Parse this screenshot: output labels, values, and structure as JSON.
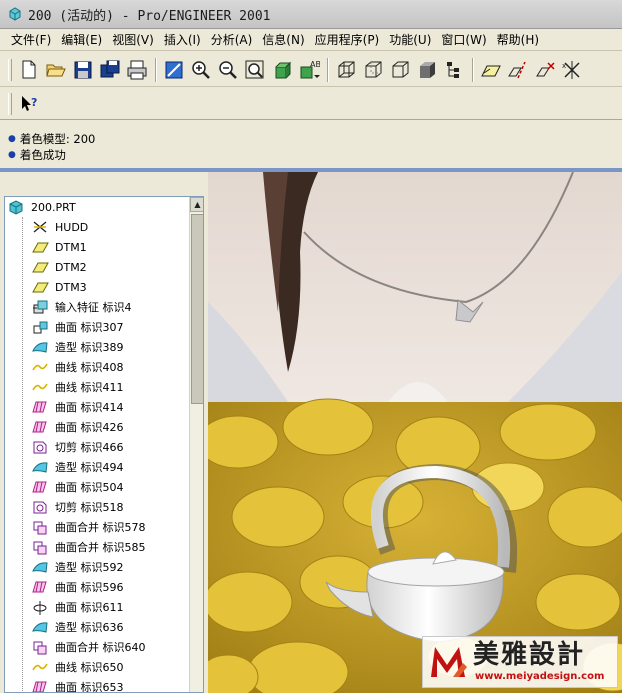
{
  "window": {
    "title": "200 (活动的) - Pro/ENGINEER 2001"
  },
  "menu": [
    "文件(F)",
    "编辑(E)",
    "视图(V)",
    "插入(I)",
    "分析(A)",
    "信息(N)",
    "应用程序(P)",
    "功能(U)",
    "窗口(W)",
    "帮助(H)"
  ],
  "toolbar1": {
    "groups": [
      [
        "new-file-icon",
        "open-folder-icon",
        "save-icon",
        "save-copy-icon",
        "print-icon"
      ],
      [
        "redraw-icon",
        "zoom-in-icon",
        "zoom-out-icon",
        "zoom-fit-icon",
        "spin-center-icon",
        "saved-views-icon"
      ],
      [
        "wireframe-icon",
        "hidden-line-icon",
        "no-hidden-icon",
        "shading-icon",
        "model-tree-icon"
      ],
      [
        "datum-plane-icon",
        "datum-axis-icon",
        "datum-point-icon",
        "coordinate-system-icon"
      ]
    ]
  },
  "toolbar2": {
    "help_icon": "context-help-icon"
  },
  "messages": [
    "着色模型: 200",
    "着色成功"
  ],
  "tree": {
    "root": "200.PRT",
    "items": [
      {
        "label": "HUDD",
        "icon": "coordinate-system-icon"
      },
      {
        "label": "DTM1",
        "icon": "datum-plane-icon"
      },
      {
        "label": "DTM2",
        "icon": "datum-plane-icon"
      },
      {
        "label": "DTM3",
        "icon": "datum-plane-icon"
      },
      {
        "label": "输入特征 标识4",
        "icon": "import-feature-icon"
      },
      {
        "label": "曲面 标识307",
        "icon": "surface-icon"
      },
      {
        "label": "造型 标识389",
        "icon": "style-icon"
      },
      {
        "label": "曲线 标识408",
        "icon": "curve-icon"
      },
      {
        "label": "曲线 标识411",
        "icon": "curve-icon"
      },
      {
        "label": "曲面 标识414",
        "icon": "boundary-surface-icon"
      },
      {
        "label": "曲面 标识426",
        "icon": "boundary-surface-icon"
      },
      {
        "label": "切剪 标识466",
        "icon": "cut-icon"
      },
      {
        "label": "造型 标识494",
        "icon": "style-icon"
      },
      {
        "label": "曲面 标识504",
        "icon": "boundary-surface-icon"
      },
      {
        "label": "切剪 标识518",
        "icon": "cut-icon"
      },
      {
        "label": "曲面合并 标识578",
        "icon": "merge-icon"
      },
      {
        "label": "曲面合并 标识585",
        "icon": "merge-icon"
      },
      {
        "label": "造型 标识592",
        "icon": "style-icon"
      },
      {
        "label": "曲面 标识596",
        "icon": "boundary-surface-icon"
      },
      {
        "label": "曲面 标识611",
        "icon": "revolve-surface-icon"
      },
      {
        "label": "造型 标识636",
        "icon": "style-icon"
      },
      {
        "label": "曲面合并 标识640",
        "icon": "merge-icon"
      },
      {
        "label": "曲线 标识650",
        "icon": "curve-icon"
      },
      {
        "label": "曲面 标识653",
        "icon": "boundary-surface-icon"
      }
    ]
  },
  "watermark": {
    "brand": "美雅設計",
    "url": "www.meiyadesign.com"
  }
}
